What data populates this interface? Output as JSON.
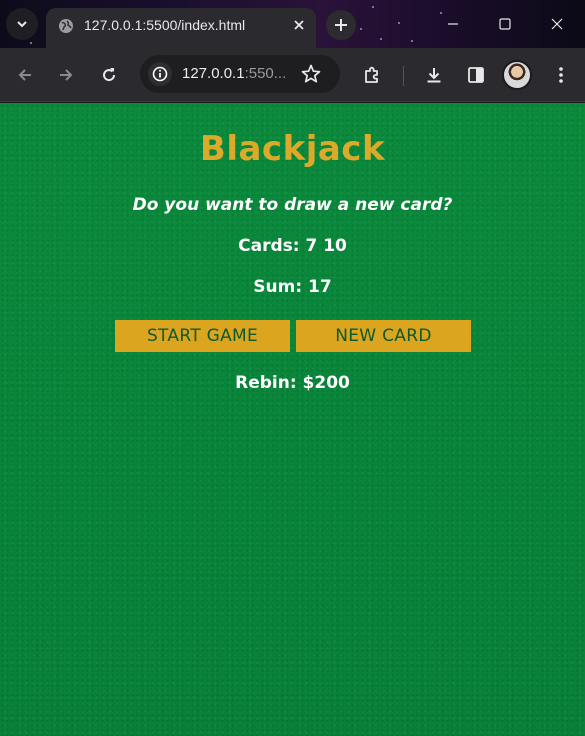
{
  "browser": {
    "tab_title": "127.0.0.1:5500/index.html",
    "url_host": "127.0.0.1",
    "url_rest": ":550..."
  },
  "game": {
    "title": "Blackjack",
    "message": "Do you want to draw a new card?",
    "cards_text": "Cards: 7 10",
    "sum_text": "Sum: 17",
    "start_button": "START GAME",
    "new_card_button": "NEW CARD",
    "player_text": "Rebin: $200"
  },
  "colors": {
    "table_green": "#0b8a3c",
    "gold": "#dca51f",
    "button_text": "#0c5a2a"
  }
}
